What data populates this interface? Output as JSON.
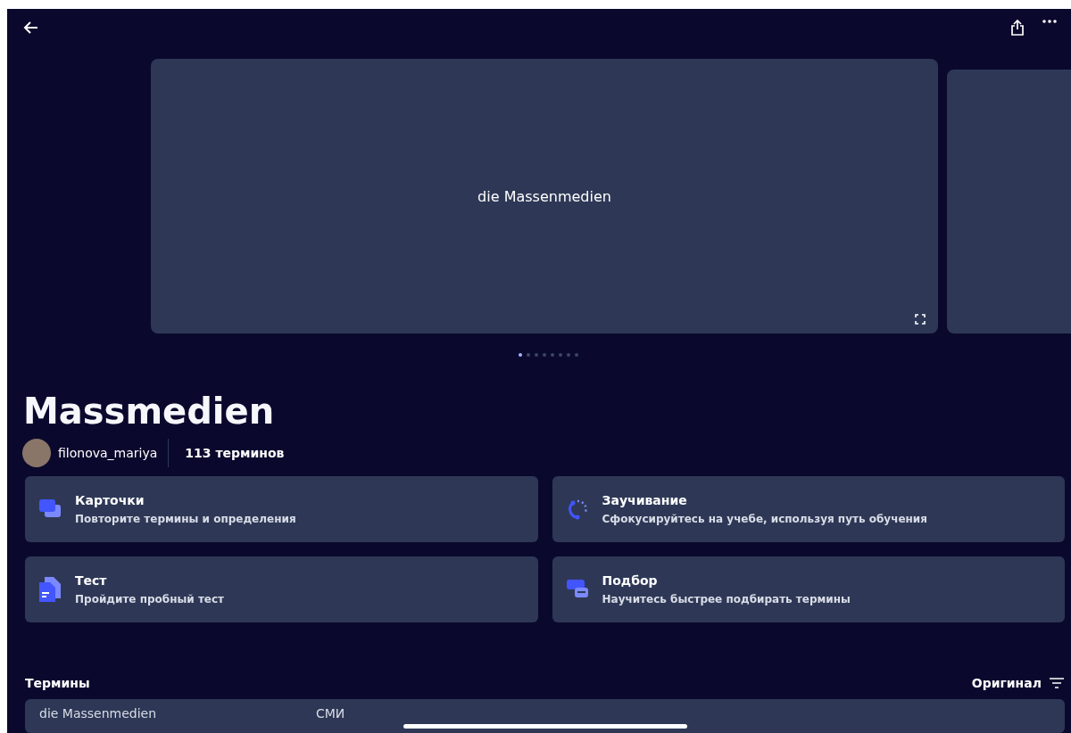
{
  "card": {
    "text": "die Massenmedien"
  },
  "pager": [
    {
      "selected": true
    },
    {
      "selected": false
    },
    {
      "selected": false
    },
    {
      "selected": false
    },
    {
      "selected": false
    },
    {
      "selected": false
    },
    {
      "selected": false
    },
    {
      "selected": false
    }
  ],
  "title": "Massmedien",
  "author": {
    "name": "filonova_mariya",
    "terms": "113 терминов"
  },
  "modes": [
    {
      "kind": "cards",
      "title": "Карточки",
      "subtitle": "Повторите термины и определения"
    },
    {
      "kind": "learn",
      "title": "Заучивание",
      "subtitle": "Сфокусируйтесь на учебе, используя путь обучения"
    },
    {
      "kind": "test",
      "title": "Тест",
      "subtitle": "Пройдите пробный тест"
    },
    {
      "kind": "match",
      "title": "Подбор",
      "subtitle": "Научитесь быстрее подбирать термины"
    }
  ],
  "terms": {
    "heading": "Термины",
    "sort": "Оригинал",
    "rows": [
      {
        "term": "die Massenmedien",
        "definition": "СМИ"
      }
    ]
  }
}
